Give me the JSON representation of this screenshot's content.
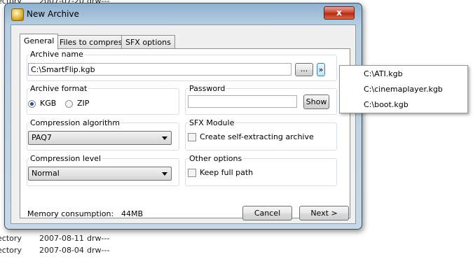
{
  "background_list": [
    {
      "type": "ectory",
      "date": "2007-07-20",
      "attrs": "drw---"
    },
    {
      "type": "ectory",
      "date": "2007-08-11",
      "attrs": "drw---"
    },
    {
      "type": "ectory",
      "date": "2007-08-04",
      "attrs": "drw---"
    }
  ],
  "window": {
    "title": "New Archive",
    "close_label": "x"
  },
  "tabs": [
    {
      "label": "General"
    },
    {
      "label": "Files to compress"
    },
    {
      "label": "SFX options"
    }
  ],
  "archive_name": {
    "group_label": "Archive name",
    "value": "C:\\SmartFlip.kgb",
    "browse_label": "...",
    "history_label": "»"
  },
  "archive_format": {
    "group_label": "Archive format",
    "options": [
      {
        "label": "KGB",
        "selected": true
      },
      {
        "label": "ZIP",
        "selected": false
      }
    ]
  },
  "password": {
    "group_label": "Password",
    "value": "",
    "show_label": "Show"
  },
  "compression_algorithm": {
    "group_label": "Compression algorithm",
    "selected": "PAQ7"
  },
  "sfx_module": {
    "group_label": "SFX Module",
    "checkbox_label": "Create self-extracting archive",
    "checked": false
  },
  "compression_level": {
    "group_label": "Compression level",
    "selected": "Normal"
  },
  "other_options": {
    "group_label": "Other options",
    "checkbox_label": "Keep full path",
    "checked": false
  },
  "footer": {
    "memory_label": "Memory consumption:",
    "memory_value": "44MB",
    "cancel_label": "Cancel",
    "next_label": "Next >"
  },
  "history_dropdown": {
    "items": [
      "C:\\ATI.kgb",
      "C:\\cinemaplayer.kgb",
      "C:\\boot.kgb"
    ]
  }
}
